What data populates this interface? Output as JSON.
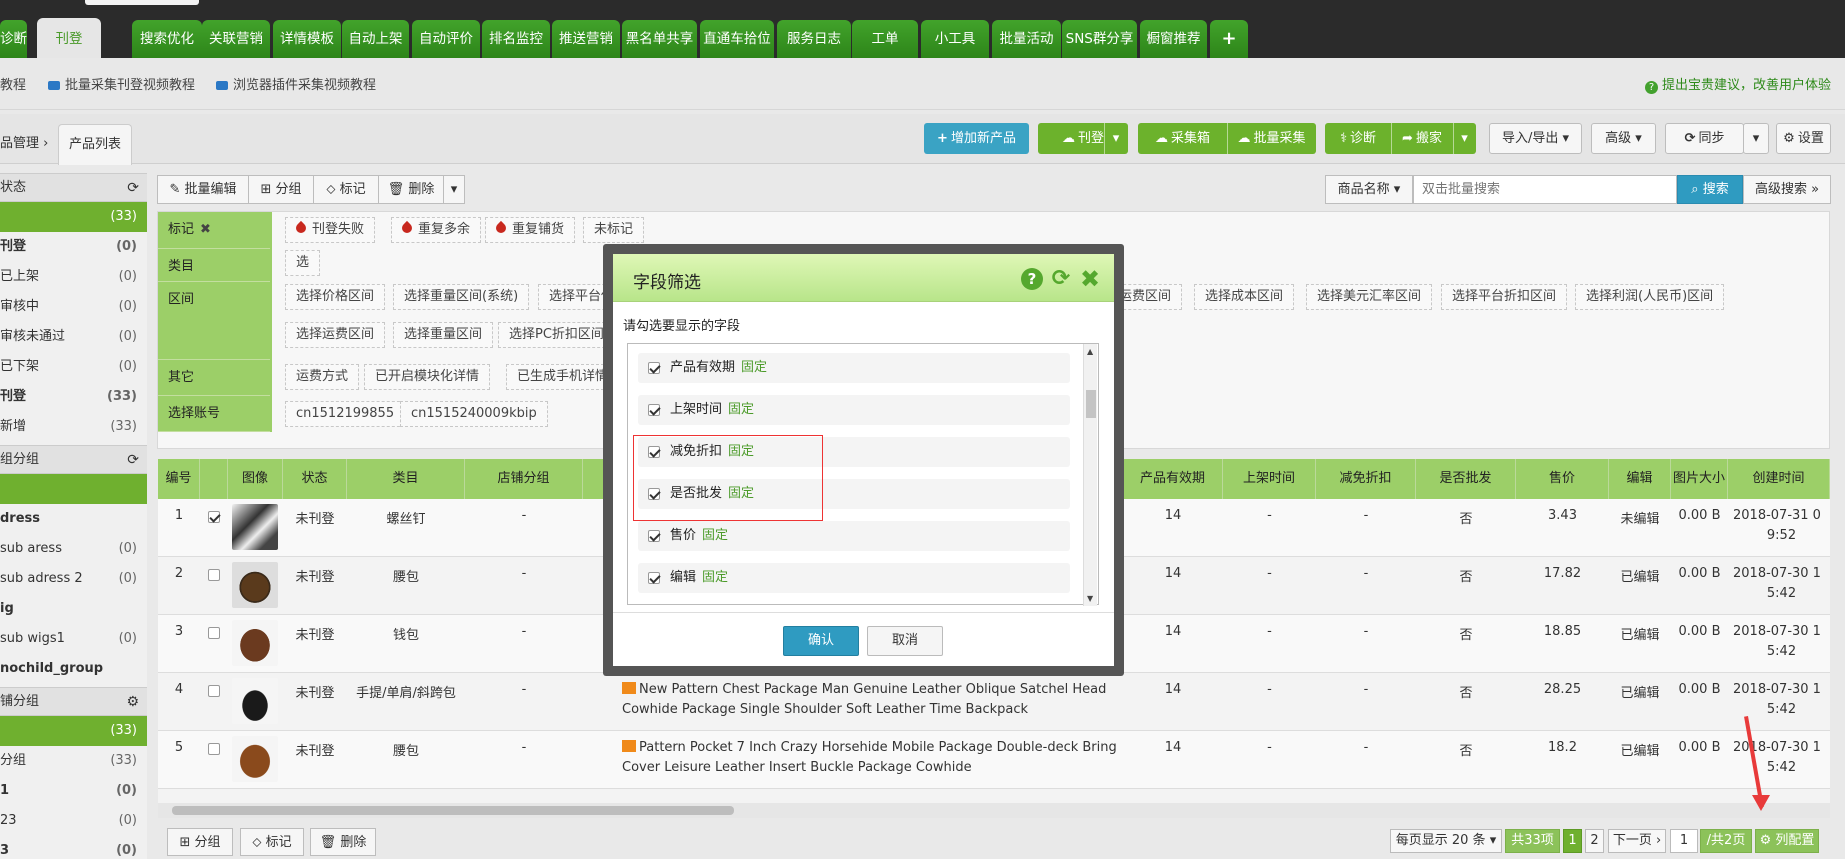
{
  "nav": {
    "tabs": [
      "诊断",
      "刊登",
      "搜索优化",
      "关联营销",
      "详情模板",
      "自动上架",
      "自动评价",
      "排名监控",
      "推送营销",
      "黑名单共享",
      "直通车拾位",
      "服务日志",
      "工单",
      "小工具",
      "批量活动",
      "SNS群分享",
      "橱窗推荐",
      "+"
    ],
    "active": "刊登"
  },
  "subbar": {
    "link0": "教程",
    "link1": "批量采集刊登视频教程",
    "link2": "浏览器插件采集视频教程",
    "help": "提出宝贵建议，改善用户体验"
  },
  "breadcrumb": {
    "parent": "品管理",
    "tab": "产品列表"
  },
  "toolbar": {
    "add_product": "增加新产品",
    "publish": "刊登",
    "collect_box": "采集箱",
    "batch_collect": "批量采集",
    "diagnose": "诊断",
    "move": "搬家",
    "import_export": "导入/导出",
    "advanced": "高级",
    "sync": "同步",
    "settings": "设置"
  },
  "actions": {
    "batch_edit": "批量编辑",
    "group": "分组",
    "mark": "标记",
    "delete": "删除"
  },
  "search": {
    "field": "商品名称",
    "placeholder": "双击批量搜索",
    "button": "搜索",
    "advanced": "高级搜索"
  },
  "sidebar": {
    "status_header": "状态",
    "status_items": [
      {
        "label": "",
        "count": "(33)",
        "selected": true
      },
      {
        "label": "刊登",
        "count": "(0)",
        "bold": true
      },
      {
        "label": "已上架",
        "count": "(0)"
      },
      {
        "label": "审核中",
        "count": "(0)"
      },
      {
        "label": "审核未通过",
        "count": "(0)"
      },
      {
        "label": "已下架",
        "count": "(0)"
      },
      {
        "label": "刊登",
        "count": "(33)",
        "bold": true
      },
      {
        "label": "新增",
        "count": "(33)"
      }
    ],
    "group_header": "组分组",
    "group_items": [
      {
        "label": "",
        "count": "",
        "selected": true
      },
      {
        "label": "dress",
        "count": "",
        "bold": true
      },
      {
        "label": "sub aress",
        "count": "(0)"
      },
      {
        "label": "sub adress 2",
        "count": "(0)"
      },
      {
        "label": "ig",
        "count": "",
        "bold": true
      },
      {
        "label": "sub wigs1",
        "count": "(0)"
      },
      {
        "label": "nochild_group",
        "count": "",
        "bold": true
      }
    ],
    "store_header": "铺分组",
    "store_items": [
      {
        "label": "",
        "count": "(33)",
        "selected": true
      },
      {
        "label": "分组",
        "count": "(33)"
      },
      {
        "label": "1",
        "count": "(0)",
        "bold": true
      },
      {
        "label": "23",
        "count": "(0)"
      },
      {
        "label": "3",
        "count": "(0)",
        "bold": true
      }
    ]
  },
  "filters": {
    "mark_label": "标记",
    "mark_chips": [
      "刊登失败",
      "重复多余",
      "重复铺货",
      "未标记"
    ],
    "category_label": "类目",
    "category_chip": "选择类目",
    "range_label": "区间",
    "range_chips_row1": [
      "选择价格区间",
      "选择重量区间(系统)",
      "选择平台佣",
      "运费区间",
      "选择成本区间",
      "选择美元汇率区间",
      "选择平台折扣区间",
      "选择利润(人民币)区间"
    ],
    "range_chips_row2": [
      "选择运费区间",
      "选择重量区间",
      "选择PC折扣区间"
    ],
    "other_label": "其它",
    "other_chips": [
      "运费方式",
      "已开启模块化详情",
      "已生成手机详情"
    ],
    "account_label": "选择账号",
    "account_chips": [
      "cn1512199855",
      "cn1515240009kbip"
    ]
  },
  "table": {
    "headers": [
      "编号",
      "",
      "图像",
      "状态",
      "类目",
      "店铺分组",
      "",
      "产品有效期",
      "上架时间",
      "减免折扣",
      "是否批发",
      "售价",
      "编辑",
      "图片大小",
      "创建时间"
    ],
    "rows": [
      {
        "no": "1",
        "checked": true,
        "status": "未刊登",
        "category": "螺丝钉",
        "group": "-",
        "title": "",
        "validity": "14",
        "online": "-",
        "discount": "-",
        "wholesale": "否",
        "price": "3.43",
        "edit": "未编辑",
        "img_size": "0.00 B",
        "created_1": "2018-07-31 0",
        "created_2": "9:52"
      },
      {
        "no": "2",
        "checked": false,
        "status": "未刊登",
        "category": "腰包",
        "group": "-",
        "title": "",
        "validity": "14",
        "online": "-",
        "discount": "-",
        "wholesale": "否",
        "price": "17.82",
        "edit": "已编辑",
        "img_size": "0.00 B",
        "created_1": "2018-07-30 1",
        "created_2": "5:42"
      },
      {
        "no": "3",
        "checked": false,
        "status": "未刊登",
        "category": "钱包",
        "group": "-",
        "title": "",
        "validity": "14",
        "online": "-",
        "discount": "-",
        "wholesale": "否",
        "price": "18.85",
        "edit": "已编辑",
        "img_size": "0.00 B",
        "created_1": "2018-07-30 1",
        "created_2": "5:42"
      },
      {
        "no": "4",
        "checked": false,
        "status": "未刊登",
        "category": "手提/单肩/斜跨包",
        "group": "-",
        "title": "New Pattern Chest Package Man Genuine Leather Oblique Satchel Head Cowhide Package Single Shoulder Soft Leather Time Backpack",
        "validity": "14",
        "online": "-",
        "discount": "-",
        "wholesale": "否",
        "price": "28.25",
        "edit": "已编辑",
        "img_size": "0.00 B",
        "created_1": "2018-07-30 1",
        "created_2": "5:42"
      },
      {
        "no": "5",
        "checked": false,
        "status": "未刊登",
        "category": "腰包",
        "group": "-",
        "title": "Pattern Pocket 7 Inch Crazy Horsehide Mobile Package Double-deck Bring Cover Leisure Leather Insert Buckle Package Cowhide",
        "validity": "14",
        "online": "-",
        "discount": "-",
        "wholesale": "否",
        "price": "18.2",
        "edit": "已编辑",
        "img_size": "0.00 B",
        "created_1": "2018-07-30 1",
        "created_2": "5:42"
      }
    ]
  },
  "pagination": {
    "per_page": "每页显示 20 条",
    "total": "共33项",
    "page1": "1",
    "page2": "2",
    "next": "下一页",
    "current": "1",
    "of_pages": "/共2页",
    "columns": "列配置"
  },
  "bottom_actions": {
    "group": "分组",
    "mark": "标记",
    "delete": "删除"
  },
  "dialog": {
    "title": "字段筛选",
    "subtitle": "请勾选要显示的字段",
    "fixed": "固定",
    "fields": [
      "产品有效期",
      "上架时间",
      "减免折扣",
      "是否批发",
      "售价",
      "编辑"
    ],
    "confirm": "确认",
    "cancel": "取消"
  },
  "colors": {
    "brand_green": "#3c9a24",
    "accent_blue": "#3aa3c4",
    "header_green": "#9ccf68",
    "annotation_red": "#e33333"
  }
}
